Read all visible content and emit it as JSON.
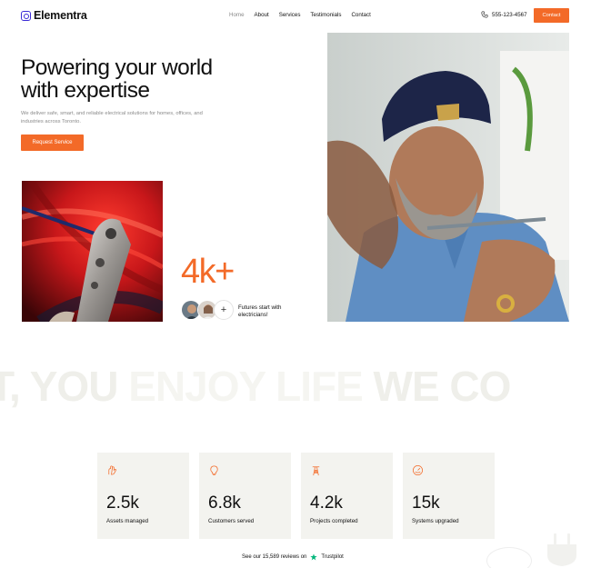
{
  "header": {
    "logo_text": "Elementra",
    "nav": [
      "Home",
      "About",
      "Services",
      "Testimonials",
      "Contact"
    ],
    "phone": "555-123-4567",
    "contact_label": "Contact"
  },
  "hero": {
    "title_line1": "Powering your world",
    "title_line2": "with expertise",
    "description": "We deliver safe, smart, and reliable electrical solutions for homes, offices, and industries across Toronto.",
    "cta_label": "Request Service"
  },
  "highlight": {
    "value": "4k+",
    "plus": "+",
    "caption": "Futures start with electricians!"
  },
  "marquee": {
    "part1": "T, YOU ",
    "part2": "ENJOY LIFE",
    "part3": "   WE CO"
  },
  "stats": [
    {
      "value": "2.5k",
      "label": "Assets managed",
      "icon": "hand-icon"
    },
    {
      "value": "6.8k",
      "label": "Customers served",
      "icon": "bulb-icon"
    },
    {
      "value": "4.2k",
      "label": "Projects completed",
      "icon": "tower-icon"
    },
    {
      "value": "15k",
      "label": "Systems upgraded",
      "icon": "gauge-icon"
    }
  ],
  "reviews": {
    "text": "See our 15,589 reviews on",
    "brand": "Trustpilot"
  },
  "colors": {
    "accent": "#f36a28",
    "brand": "#3b2bd6",
    "card_bg": "#f3f3ef",
    "trustpilot": "#00b67a"
  }
}
